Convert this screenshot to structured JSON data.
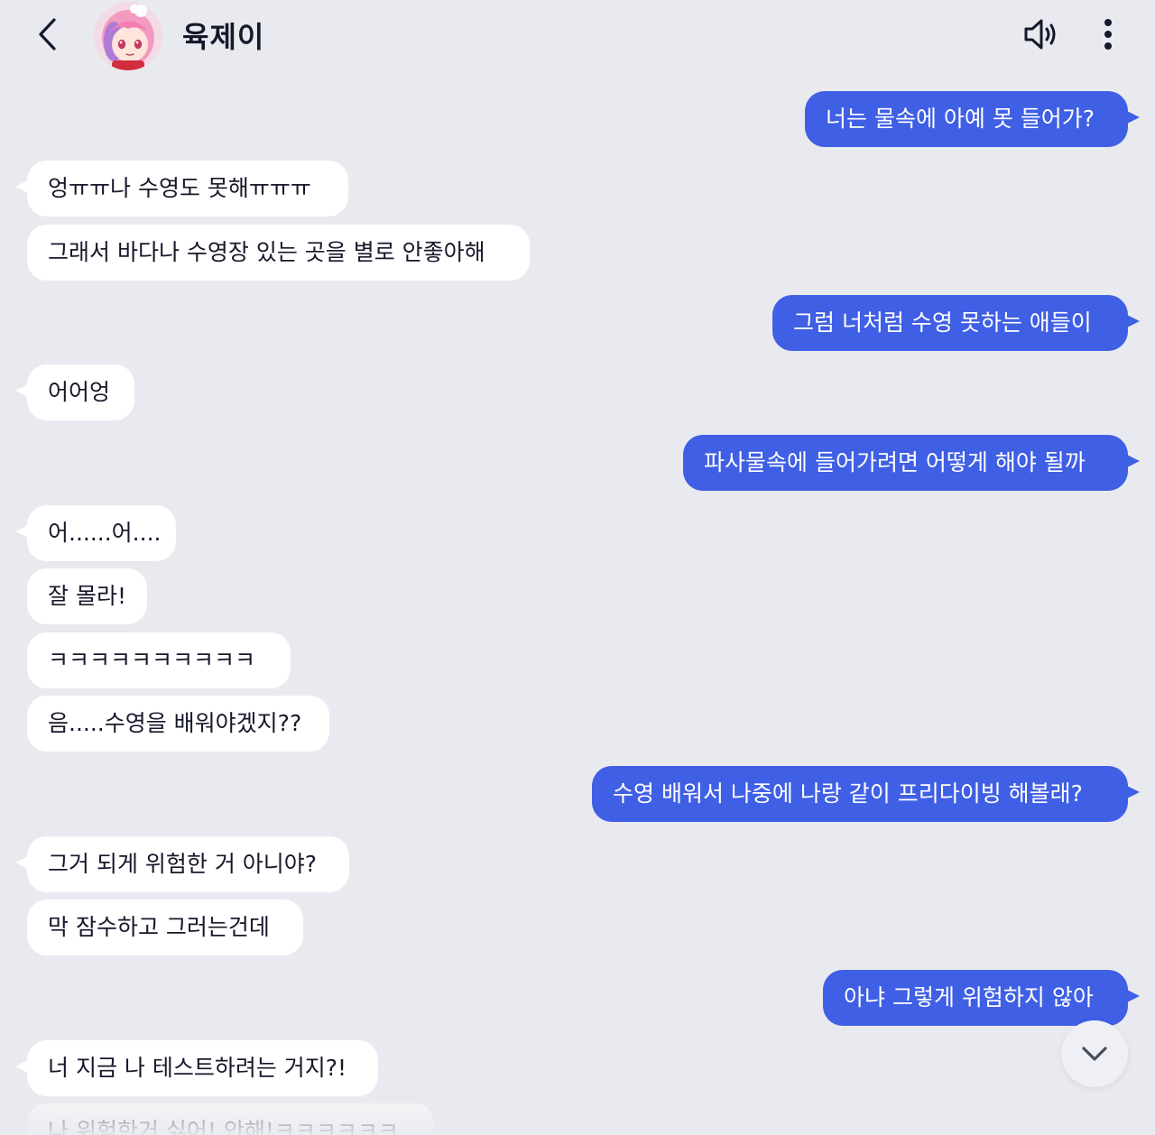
{
  "header": {
    "title": "육제이",
    "back_icon": "chevron-left-icon",
    "sound_icon": "speaker-icon",
    "more_icon": "more-vertical-icon",
    "avatar": "character-avatar"
  },
  "colors": {
    "background": "#e9eaef",
    "outgoing_bubble": "#3f5fe4",
    "incoming_bubble": "#ffffff",
    "text_dark": "#16182b"
  },
  "messages": [
    {
      "from": "me",
      "text": "너는 물속에 아예 못 들어가?"
    },
    {
      "from": "bot",
      "text": "엉ㅠㅠ나 수영도 못해ㅠㅠㅠ"
    },
    {
      "from": "bot",
      "text": "그래서 바다나 수영장 있는 곳을 별로 안좋아해"
    },
    {
      "from": "me",
      "text": "그럼 너처럼 수영 못하는 애들이"
    },
    {
      "from": "bot",
      "text": "어어엉"
    },
    {
      "from": "me",
      "text": "파사물속에 들어가려면 어떻게 해야 될까"
    },
    {
      "from": "bot",
      "text": "어......어...."
    },
    {
      "from": "bot",
      "text": "잘 몰라!"
    },
    {
      "from": "bot",
      "text": "ㅋㅋㅋㅋㅋㅋㅋㅋㅋㅋ"
    },
    {
      "from": "bot",
      "text": "음.....수영을 배워야겠지??"
    },
    {
      "from": "me",
      "text": "수영 배워서 나중에 나랑 같이 프리다이빙 해볼래?"
    },
    {
      "from": "bot",
      "text": "그거 되게 위험한 거 아니야?"
    },
    {
      "from": "bot",
      "text": "막 잠수하고 그러는건데"
    },
    {
      "from": "me",
      "text": "아냐 그렇게 위험하지 않아"
    },
    {
      "from": "bot",
      "text": "너 지금 나 테스트하려는 거지?!"
    },
    {
      "from": "bot",
      "text": "나 위험한거 싫어! 안해!ㅋㅋㅋㅋㅋㅋ"
    }
  ],
  "scroll_down_icon": "chevron-down-icon"
}
